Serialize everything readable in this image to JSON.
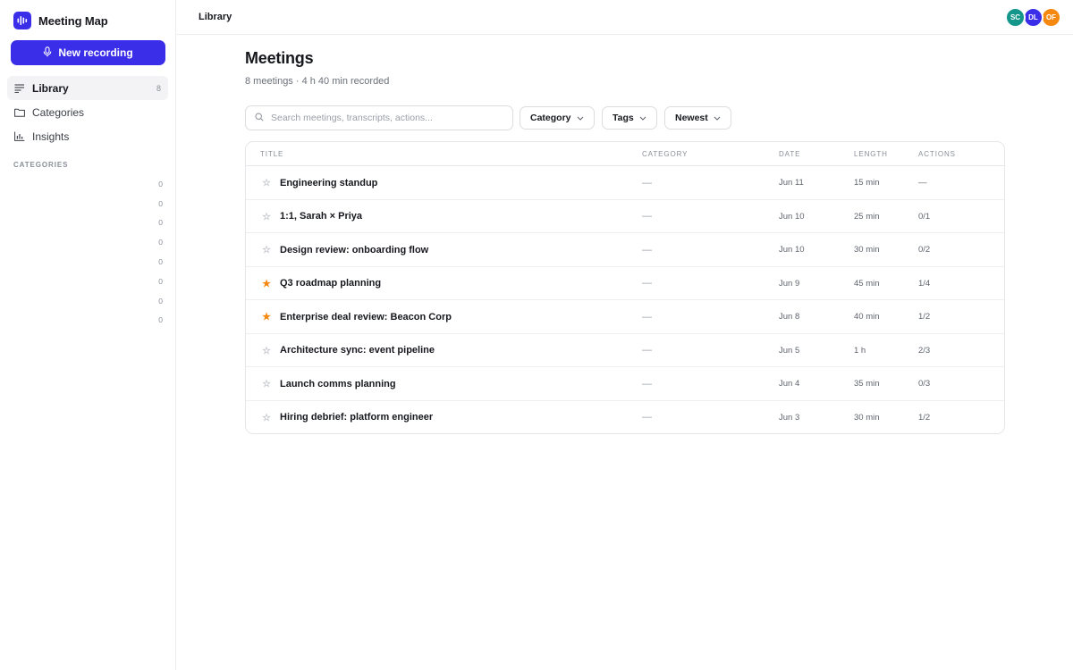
{
  "app": {
    "name": "Meeting Map",
    "accent": "#3a2ee8"
  },
  "sidebar": {
    "new_recording_label": "New recording",
    "nav": [
      {
        "label": "Library",
        "count": "8",
        "icon": "library-lines-icon",
        "active": true
      },
      {
        "label": "Categories",
        "count": "",
        "icon": "folder-icon",
        "active": false
      },
      {
        "label": "Insights",
        "count": "",
        "icon": "bar-chart-icon",
        "active": false
      }
    ],
    "categories_heading": "CATEGORIES",
    "category_counts": [
      "0",
      "0",
      "0",
      "0",
      "0",
      "0",
      "0",
      "0"
    ]
  },
  "topbar": {
    "breadcrumb": "Library",
    "avatars": [
      {
        "initials": "SC",
        "color": "#14968a"
      },
      {
        "initials": "DL",
        "color": "#3a2ee8"
      },
      {
        "initials": "OF",
        "color": "#f5880f"
      }
    ]
  },
  "main": {
    "title": "Meetings",
    "subtitle": "8 meetings · 4 h 40 min recorded",
    "search": {
      "placeholder": "Search meetings, transcripts, actions...",
      "value": ""
    },
    "filters": [
      {
        "label": "Category"
      },
      {
        "label": "Tags"
      },
      {
        "label": "Newest"
      }
    ],
    "table": {
      "headers": {
        "title": "TITLE",
        "category": "CATEGORY",
        "date": "DATE",
        "length": "LENGTH",
        "actions": "ACTIONS"
      },
      "rows": [
        {
          "title": "Engineering standup",
          "starred": false,
          "category": "—",
          "date": "Jun 11",
          "length": "15 min",
          "actions": "—"
        },
        {
          "title": "1:1, Sarah × Priya",
          "starred": false,
          "category": "—",
          "date": "Jun 10",
          "length": "25 min",
          "actions": "0/1"
        },
        {
          "title": "Design review: onboarding flow",
          "starred": false,
          "category": "—",
          "date": "Jun 10",
          "length": "30 min",
          "actions": "0/2"
        },
        {
          "title": "Q3 roadmap planning",
          "starred": true,
          "category": "—",
          "date": "Jun 9",
          "length": "45 min",
          "actions": "1/4"
        },
        {
          "title": "Enterprise deal review: Beacon Corp",
          "starred": true,
          "category": "—",
          "date": "Jun 8",
          "length": "40 min",
          "actions": "1/2"
        },
        {
          "title": "Architecture sync: event pipeline",
          "starred": false,
          "category": "—",
          "date": "Jun 5",
          "length": "1 h",
          "actions": "2/3"
        },
        {
          "title": "Launch comms planning",
          "starred": false,
          "category": "—",
          "date": "Jun 4",
          "length": "35 min",
          "actions": "0/3"
        },
        {
          "title": "Hiring debrief: platform engineer",
          "starred": false,
          "category": "—",
          "date": "Jun 3",
          "length": "30 min",
          "actions": "1/2"
        }
      ]
    },
    "star_colors": {
      "on": "#f5880f",
      "off": "#c4c7cd"
    }
  }
}
